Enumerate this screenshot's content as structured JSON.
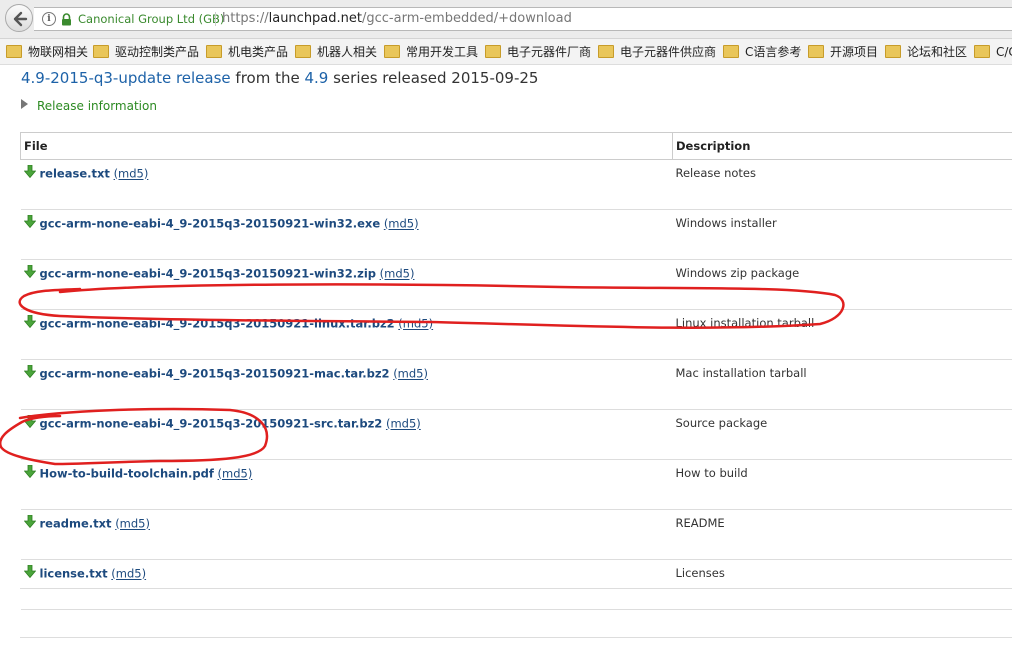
{
  "browser": {
    "org_label": "Canonical Group Ltd (GB)",
    "url_prefix": "https://",
    "url_host": "launchpad.net",
    "url_path": "/gcc-arm-embedded/+download"
  },
  "bookmarks": [
    {
      "label": "物联网相关"
    },
    {
      "label": "驱动控制类产品"
    },
    {
      "label": "机电类产品"
    },
    {
      "label": "机器人相关"
    },
    {
      "label": "常用开发工具"
    },
    {
      "label": "电子元器件厂商"
    },
    {
      "label": "电子元器件供应商"
    },
    {
      "label": "C语言参考"
    },
    {
      "label": "开源项目"
    },
    {
      "label": "论坛和社区"
    },
    {
      "label": "C/C"
    }
  ],
  "release": {
    "name": "4.9-2015-q3-update release",
    "from_the": " from the ",
    "series": "4.9",
    "series_released": " series released 2015-09-25",
    "info_link": "Release information"
  },
  "table": {
    "headers": {
      "file": "File",
      "description": "Description"
    },
    "rows": [
      {
        "file": "release.txt",
        "md5": "(md5)",
        "description": "Release notes"
      },
      {
        "file": "gcc-arm-none-eabi-4_9-2015q3-20150921-win32.exe",
        "md5": "(md5)",
        "description": "Windows installer"
      },
      {
        "file": "gcc-arm-none-eabi-4_9-2015q3-20150921-win32.zip",
        "md5": "(md5)",
        "description": "Windows zip package"
      },
      {
        "file": "gcc-arm-none-eabi-4_9-2015q3-20150921-linux.tar.bz2",
        "md5": "(md5)",
        "description": "Linux installation tarball"
      },
      {
        "file": "gcc-arm-none-eabi-4_9-2015q3-20150921-mac.tar.bz2",
        "md5": "(md5)",
        "description": "Mac installation tarball"
      },
      {
        "file": "gcc-arm-none-eabi-4_9-2015q3-20150921-src.tar.bz2",
        "md5": "(md5)",
        "description": "Source package"
      },
      {
        "file": "How-to-build-toolchain.pdf",
        "md5": "(md5)",
        "description": "How to build"
      },
      {
        "file": "readme.txt",
        "md5": "(md5)",
        "description": "README"
      },
      {
        "file": "license.txt",
        "md5": "(md5)",
        "description": "Licenses"
      }
    ]
  },
  "colors": {
    "link": "#1d62a8",
    "file_link": "#1d4a7e",
    "secure_green": "#3a8a2e",
    "annotation_red": "#e0201f",
    "download_arrow": "#4aa53a"
  },
  "icons": [
    "back-arrow-icon",
    "info-icon",
    "lock-icon",
    "folder-icon",
    "disclosure-triangle-icon",
    "download-arrow-icon"
  ]
}
